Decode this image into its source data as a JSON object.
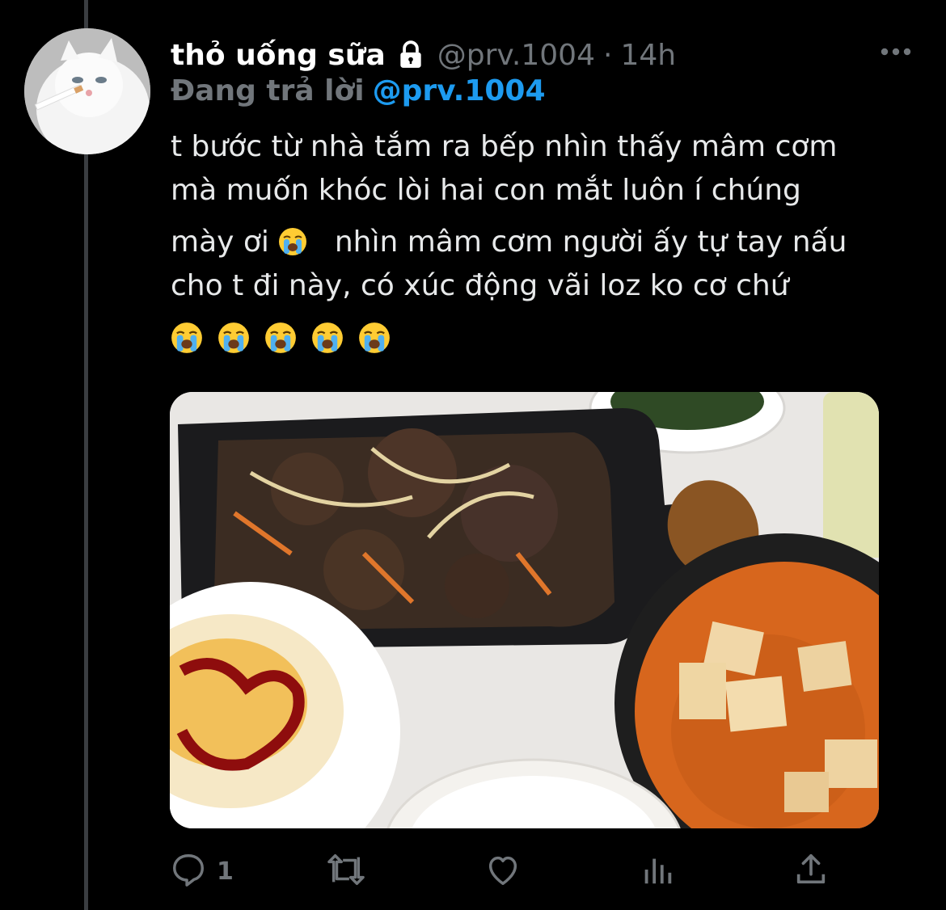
{
  "tweet": {
    "display_name": "thỏ uống sữa",
    "handle": "@prv.1004",
    "separator": "·",
    "time": "14h",
    "replying_prefix": "Đang trả lời",
    "replying_to": "@prv.1004",
    "text_lines": [
      "t bước từ nhà tắm ra bếp nhìn thấy mâm cơm",
      "mà muốn khóc lòi hai con mắt luôn í chúng",
      "mày ơi",
      "nhìn mâm cơm người ấy tự tay nấu",
      "cho t đi này, có xúc động vãi loz ko cơ chứ"
    ],
    "emoji_name": "loudly-crying-face-emoji",
    "emoji_count": 5
  },
  "actions": {
    "reply_count": "1",
    "retweet_count": "",
    "like_count": "",
    "views_count": ""
  },
  "icons": {
    "lock": "lock-icon",
    "more": "more-icon",
    "reply": "reply-icon",
    "retweet": "retweet-icon",
    "like": "like-icon",
    "analytics": "analytics-icon",
    "share": "share-icon"
  },
  "colors": {
    "background": "#000000",
    "text": "#e7e9ea",
    "muted": "#71767b",
    "accent": "#1d9bf0",
    "thread_line": "#3a3d41"
  }
}
